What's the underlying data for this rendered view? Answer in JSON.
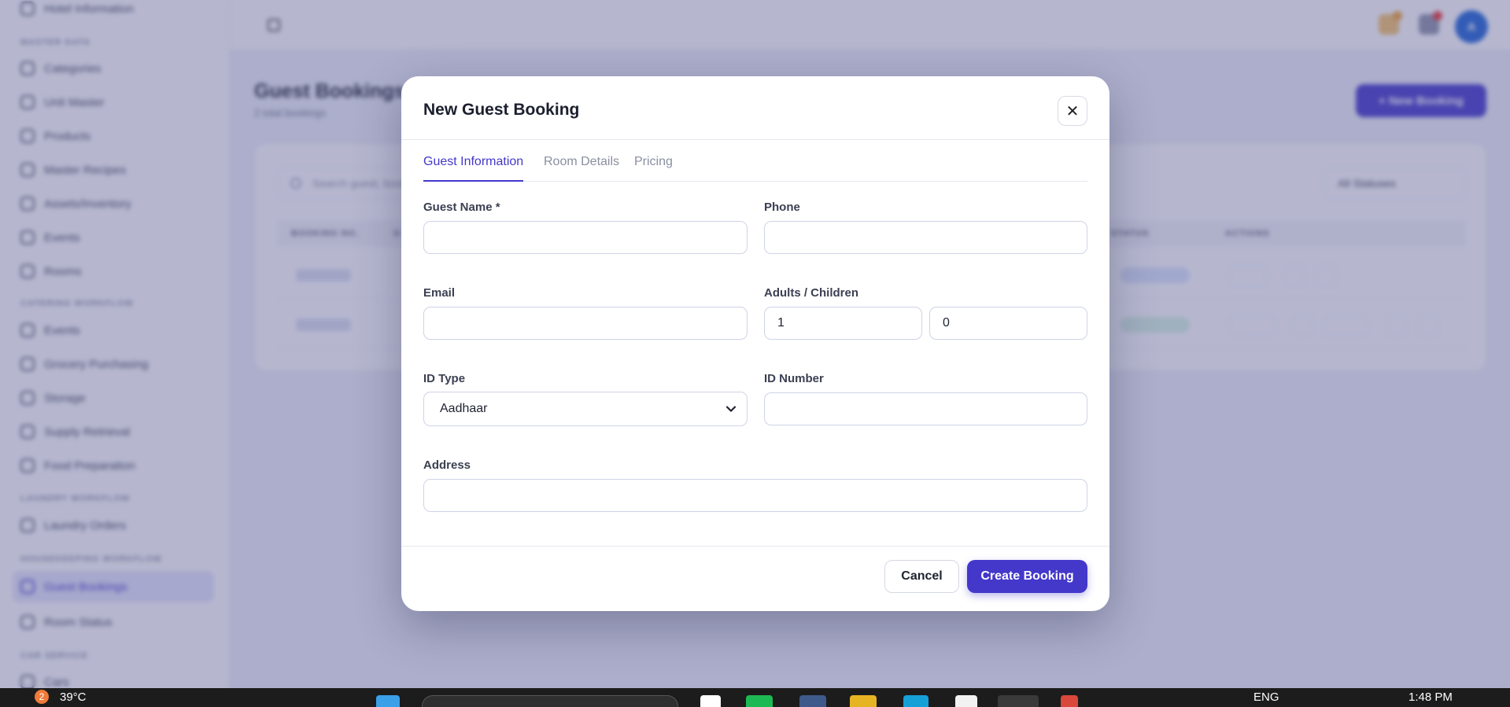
{
  "background": {
    "sidebar": {
      "items": [
        {
          "label": "Hotel Information"
        },
        {
          "label": "Categories"
        },
        {
          "label": "Unit Master"
        },
        {
          "label": "Products"
        },
        {
          "label": "Master Recipes"
        },
        {
          "label": "Assets/Inventory"
        },
        {
          "label": "Events"
        },
        {
          "label": "Rooms"
        },
        {
          "label": "Events"
        },
        {
          "label": "Grocery Purchasing"
        },
        {
          "label": "Storage"
        },
        {
          "label": "Supply Retrieval"
        },
        {
          "label": "Food Preparation"
        },
        {
          "label": "Laundry Orders"
        },
        {
          "label": "Guest Bookings"
        },
        {
          "label": "Room Status"
        },
        {
          "label": "Cars"
        }
      ],
      "sections": [
        "MASTER DATA",
        "CATERING WORKFLOW",
        "LAUNDRY WORKFLOW",
        "HOUSEKEEPING WORKFLOW",
        "CAR SERVICE"
      ]
    },
    "page_title": "Guest Bookings",
    "page_subtitle": "2 total bookings",
    "new_booking_label": "+ New Booking",
    "search_placeholder": "Search guest, booking...",
    "filter_label": "All Statuses",
    "table_headers": [
      "BOOKING NO.",
      "G",
      "STATUS",
      "ACTIONS"
    ],
    "user_initial": "A"
  },
  "modal": {
    "title": "New Guest Booking",
    "close_symbol": "✕",
    "tabs": [
      {
        "label": "Guest Information",
        "active": true
      },
      {
        "label": "Room Details",
        "active": false
      },
      {
        "label": "Pricing",
        "active": false
      }
    ],
    "fields": {
      "guest_name": {
        "label": "Guest Name *",
        "value": ""
      },
      "phone": {
        "label": "Phone",
        "value": ""
      },
      "email": {
        "label": "Email",
        "value": ""
      },
      "adults_children": {
        "label": "Adults / Children",
        "adults": "1",
        "children": "0"
      },
      "id_type": {
        "label": "ID Type",
        "value": "Aadhaar"
      },
      "id_number": {
        "label": "ID Number",
        "value": ""
      },
      "address": {
        "label": "Address",
        "value": ""
      }
    },
    "buttons": {
      "cancel": "Cancel",
      "create": "Create Booking"
    }
  },
  "taskbar": {
    "temperature": "39°C",
    "weather_badge": "2",
    "language": "ENG",
    "time": "1:48 PM"
  },
  "colors": {
    "accent": "#4338ca",
    "overlay": "#50548c"
  }
}
